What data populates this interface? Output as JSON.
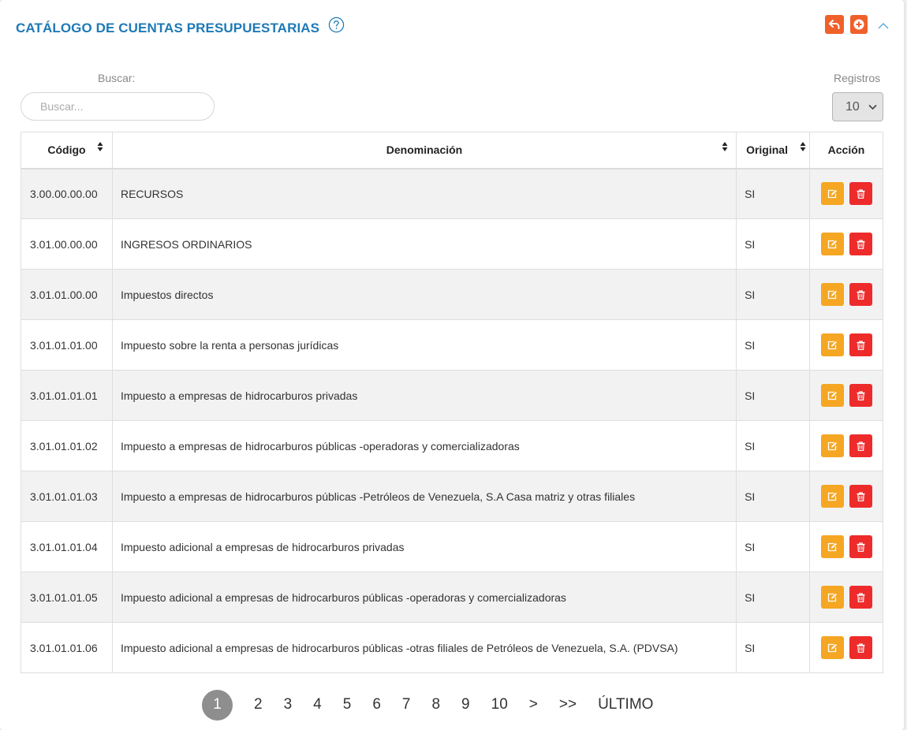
{
  "header": {
    "title": "CATÁLOGO DE CUENTAS PRESUPUESTARIAS",
    "help_icon": "question-circle-icon",
    "back_icon": "undo-arrow-icon",
    "add_icon": "plus-circle-icon",
    "collapse_icon": "chevron-up-icon"
  },
  "search": {
    "label": "Buscar:",
    "placeholder": "Buscar...",
    "value": ""
  },
  "records": {
    "label": "Registros",
    "selected": "10"
  },
  "table": {
    "columns": [
      "Código",
      "Denominación",
      "Original",
      "Acción"
    ],
    "rows": [
      {
        "code": "3.00.00.00.00",
        "name": "RECURSOS",
        "original": "SI"
      },
      {
        "code": "3.01.00.00.00",
        "name": "INGRESOS ORDINARIOS",
        "original": "SI"
      },
      {
        "code": "3.01.01.00.00",
        "name": "Impuestos directos",
        "original": "SI"
      },
      {
        "code": "3.01.01.01.00",
        "name": "Impuesto sobre la renta a personas jurídicas",
        "original": "SI"
      },
      {
        "code": "3.01.01.01.01",
        "name": "Impuesto a empresas de hidrocarburos privadas",
        "original": "SI"
      },
      {
        "code": "3.01.01.01.02",
        "name": "Impuesto a empresas de hidrocarburos públicas -operadoras y comercializadoras",
        "original": "SI"
      },
      {
        "code": "3.01.01.01.03",
        "name": "Impuesto a empresas de hidrocarburos públicas -Petróleos de Venezuela, S.A Casa matriz y otras filiales",
        "original": "SI"
      },
      {
        "code": "3.01.01.01.04",
        "name": "Impuesto adicional a empresas de hidrocarburos privadas",
        "original": "SI"
      },
      {
        "code": "3.01.01.01.05",
        "name": "Impuesto adicional a empresas de hidrocarburos públicas -operadoras y comercializadoras",
        "original": "SI"
      },
      {
        "code": "3.01.01.01.06",
        "name": "Impuesto adicional a empresas de hidrocarburos públicas -otras filiales de Petróleos de Venezuela, S.A. (PDVSA)",
        "original": "SI"
      }
    ]
  },
  "pagination": {
    "active": "1",
    "pages": [
      "1",
      "2",
      "3",
      "4",
      "5",
      "6",
      "7",
      "8",
      "9",
      "10"
    ],
    "next": ">",
    "fast_forward": ">>",
    "last": "ÚLTIMO"
  },
  "colors": {
    "title": "#1e79b6",
    "header_button": "#f0602a",
    "edit_button": "#f5a623",
    "delete_button": "#ee2b2b",
    "active_page": "#8e8e8e"
  }
}
